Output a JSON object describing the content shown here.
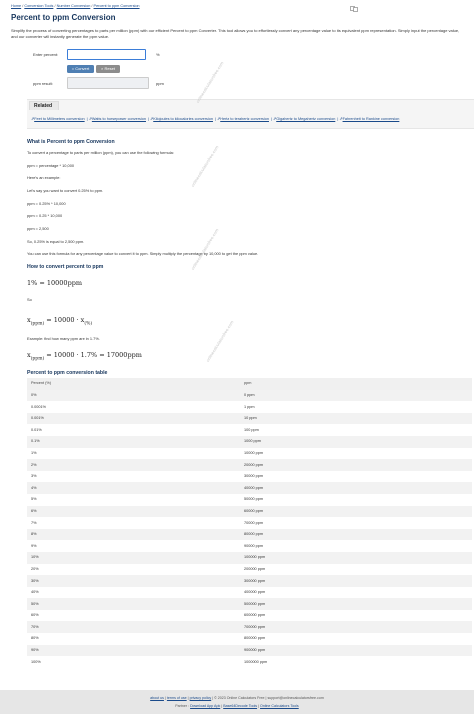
{
  "breadcrumb": {
    "home": "Home",
    "conversion_tools": "Conversion Tools",
    "number_conversion": "Number Conversion",
    "current": "Percent to ppm Conversion",
    "separator": "/"
  },
  "page_title": "Percent to ppm Conversion",
  "intro": "Simplify the process of converting percentages to parts per million (ppm) with our efficient Percent to ppm Converter. This tool allows you to effortlessly convert any percentage value to its equivalent ppm representation. Simply input the percentage value, and our converter will instantly generate the ppm value.",
  "calculator": {
    "percent_label": "Enter percent:",
    "percent_value": "",
    "percent_unit": "%",
    "convert_label": "= Convert",
    "reset_label": "× Reset",
    "result_label": "ppm result:",
    "result_value": "",
    "result_unit": "ppm"
  },
  "related": {
    "title": "Related",
    "links": [
      "Feet to Millimeters conversion",
      "Watts to horsepower conversion",
      "Kilojoules to kilocalories conversion",
      "Hertz to terahertz conversion",
      "Gigahertz to Megahertz conversion",
      "Fahrenheit to Rankine conversion"
    ],
    "separator": "|"
  },
  "article": {
    "h_what": "What is Percent to ppm Conversion",
    "p1": "To convert a percentage to parts per million (ppm), you can use the following formula:",
    "p2": "ppm = percentage * 10,000",
    "p3": "Here's an example:",
    "p4": "Let's say you want to convert 0.25% to ppm.",
    "p5": "ppm = 0.25% * 10,000",
    "p6": "ppm = 0.25 * 10,000",
    "p7": "ppm = 2,500",
    "p8": "So, 0.25% is equal to 2,500 ppm.",
    "p9": "You can use this formula for any percentage value to convert it to ppm. Simply multiply the percentage by 10,000 to get the ppm value.",
    "h_how": "How to convert percent to ppm",
    "formula1": "1% = 10000ppm",
    "so": "So",
    "formula2_lhs": "x",
    "formula2_sub_lhs": "(ppm)",
    "formula2_mid": " = 10000 · x",
    "formula2_sub_rhs": "(%)",
    "example": "Example: find how many ppm are in 1.7%.",
    "formula3_lhs": "x",
    "formula3_sub": "(ppm)",
    "formula3_rhs": " = 10000 · 1.7% = 17000ppm",
    "h_table": "Percent to ppm conversion table"
  },
  "table": {
    "headers": [
      "Percent (%)",
      "ppm"
    ],
    "rows": [
      [
        "0%",
        "0 ppm"
      ],
      [
        "0.0001%",
        "1 ppm"
      ],
      [
        "0.001%",
        "10 ppm"
      ],
      [
        "0.01%",
        "100 ppm"
      ],
      [
        "0.1%",
        "1000 ppm"
      ],
      [
        "1%",
        "10000 ppm"
      ],
      [
        "2%",
        "20000 ppm"
      ],
      [
        "3%",
        "30000 ppm"
      ],
      [
        "4%",
        "40000 ppm"
      ],
      [
        "5%",
        "50000 ppm"
      ],
      [
        "6%",
        "60000 ppm"
      ],
      [
        "7%",
        "70000 ppm"
      ],
      [
        "8%",
        "80000 ppm"
      ],
      [
        "9%",
        "90000 ppm"
      ],
      [
        "10%",
        "100000 ppm"
      ],
      [
        "20%",
        "200000 ppm"
      ],
      [
        "30%",
        "300000 ppm"
      ],
      [
        "40%",
        "400000 ppm"
      ],
      [
        "50%",
        "500000 ppm"
      ],
      [
        "60%",
        "600000 ppm"
      ],
      [
        "70%",
        "700000 ppm"
      ],
      [
        "80%",
        "800000 ppm"
      ],
      [
        "90%",
        "900000 ppm"
      ],
      [
        "100%",
        "1000000 ppm"
      ]
    ]
  },
  "footer": {
    "about": "about us",
    "terms": "terms of use",
    "privacy": "privacy policy",
    "copyright": "© 2023 Online Calculators Free",
    "email": "support@onlinecalculatorsfree.com",
    "partner_label": "Partner :",
    "partner_links": [
      "Download App Apk",
      "Base64Decode Tools",
      "Online Calculators Tools"
    ],
    "separator": "|"
  },
  "watermark": "onlinecalculatorsfree.com",
  "colors": {
    "title": "#17365d",
    "link": "#1a4a8a",
    "convert_button": "#4f7fb3",
    "reset_button": "#8c8c8c"
  }
}
